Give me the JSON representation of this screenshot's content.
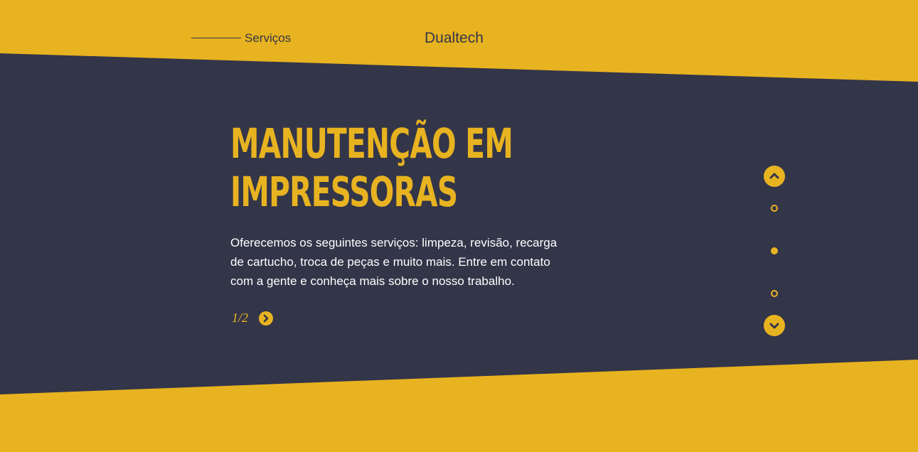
{
  "header": {
    "nav_link": "Serviços",
    "brand": "Dualtech"
  },
  "hero": {
    "title_line1": "MANUTENÇÃO EM",
    "title_line2": "IMPRESSORAS",
    "description": "Oferecemos os seguintes serviços: limpeza, revisão, recarga de cartucho, troca de peças e muito mais. Entre em contato com a gente e conheça mais sobre o nosso trabalho.",
    "counter": "1/2"
  },
  "pager": {
    "active_index": 2,
    "dots": 3
  },
  "colors": {
    "accent": "#E8B320",
    "dark": "#333549",
    "text_light": "#FFFFFF"
  },
  "icons": {
    "next": "chevron-right-icon",
    "up": "chevron-up-icon",
    "down": "chevron-down-icon"
  }
}
